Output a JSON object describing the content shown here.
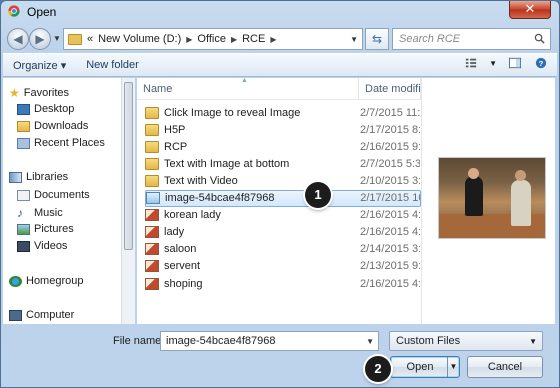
{
  "window": {
    "title": "Open",
    "close_glyph": "✕"
  },
  "address": {
    "prefix": "«",
    "crumbs": [
      "New Volume (D:)",
      "Office",
      "RCE"
    ],
    "search_placeholder": "Search RCE"
  },
  "toolbar": {
    "organize": "Organize ▾",
    "new_folder": "New folder"
  },
  "nav": {
    "favorites": "Favorites",
    "favorites_items": [
      "Desktop",
      "Downloads",
      "Recent Places"
    ],
    "libraries": "Libraries",
    "libraries_items": [
      "Documents",
      "Music",
      "Pictures",
      "Videos"
    ],
    "homegroup": "Homegroup",
    "computer": "Computer"
  },
  "columns": {
    "name": "Name",
    "date": "Date modifi"
  },
  "files": [
    {
      "name": "Click Image to reveal Image",
      "date": "2/7/2015 11:",
      "type": "folder"
    },
    {
      "name": "H5P",
      "date": "2/17/2015 8:",
      "type": "folder"
    },
    {
      "name": "RCP",
      "date": "2/16/2015 9:",
      "type": "folder"
    },
    {
      "name": "Text with Image at bottom",
      "date": "2/7/2015 5:3",
      "type": "folder"
    },
    {
      "name": "Text with Video",
      "date": "2/10/2015 3:",
      "type": "folder"
    },
    {
      "name": "image-54bcae4f87968",
      "date": "2/17/2015 10",
      "type": "image",
      "selected": true
    },
    {
      "name": "korean lady",
      "date": "2/16/2015 4:",
      "type": "jpg"
    },
    {
      "name": "lady",
      "date": "2/16/2015 4:",
      "type": "jpg"
    },
    {
      "name": "saloon",
      "date": "2/14/2015 3:",
      "type": "jpg"
    },
    {
      "name": "servent",
      "date": "2/13/2015 9:",
      "type": "jpg"
    },
    {
      "name": "shoping",
      "date": "2/16/2015 4:",
      "type": "jpg"
    }
  ],
  "footer": {
    "file_name_label": "File name:",
    "file_name_value": "image-54bcae4f87968",
    "filter": "Custom Files",
    "open": "Open",
    "cancel": "Cancel"
  },
  "badges": [
    "1",
    "2"
  ]
}
